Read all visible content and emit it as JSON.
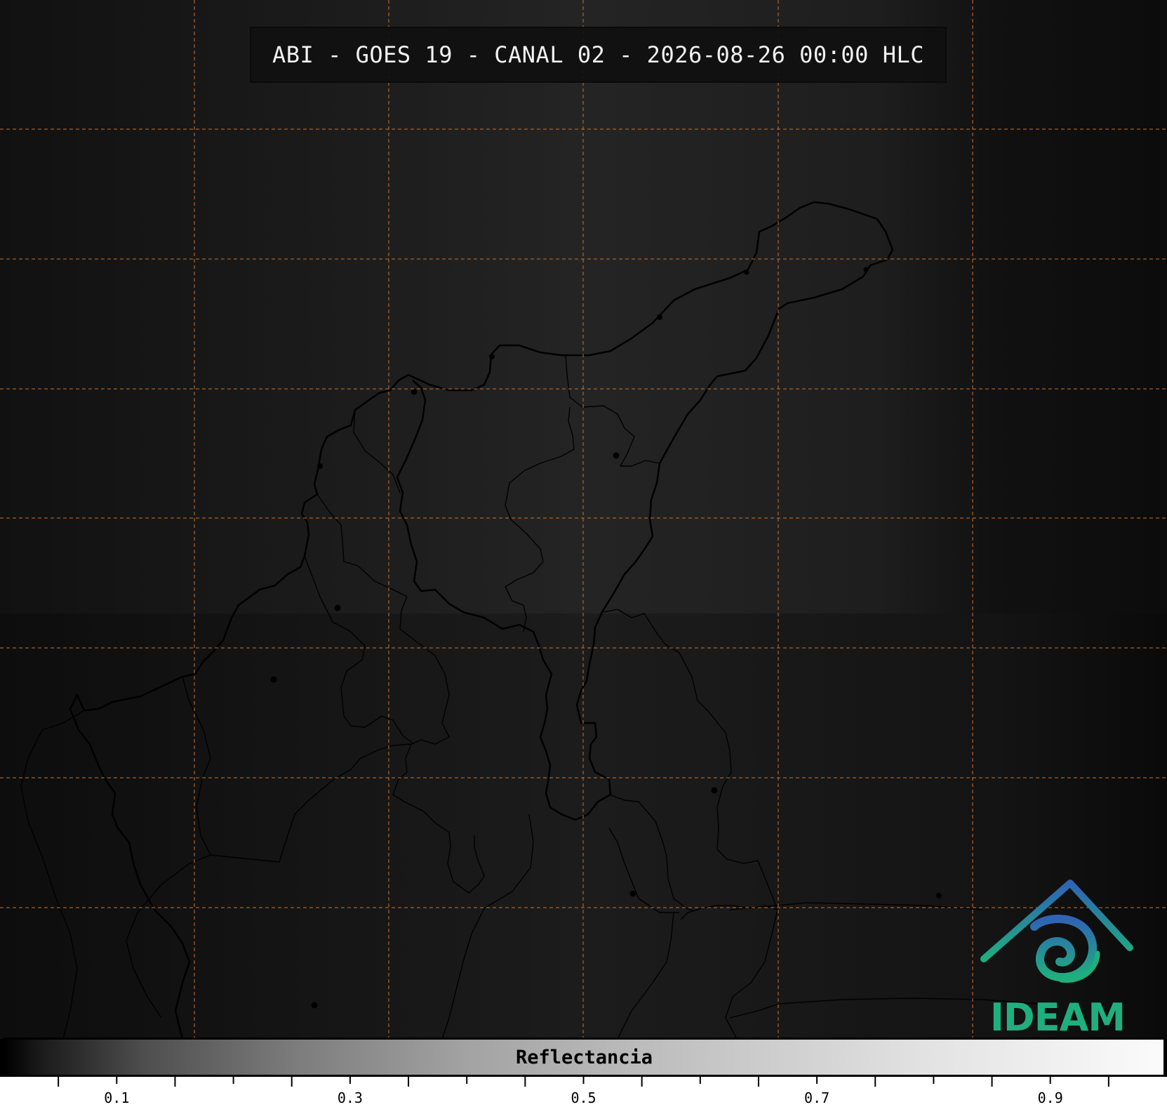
{
  "title": "ABI - GOES 19 - CANAL 02 - 2026-08-26 00:00 HLC",
  "colors": {
    "gridline": "#c8742f",
    "boundary": "#000000",
    "logo_teal": "#1faf7e",
    "logo_blue": "#2f63b5"
  },
  "logo": {
    "text": "IDEAM",
    "icon": "ideam-logo-icon"
  },
  "colorbar": {
    "label": "Reflectancia",
    "range": [
      0.0,
      1.0
    ],
    "ticks": [
      "0.1",
      "0.3",
      "0.5",
      "0.7",
      "0.9"
    ],
    "colormap": "grayscale"
  },
  "map": {
    "region": "Caribbean region of Colombia",
    "gridlines": "dashed"
  }
}
